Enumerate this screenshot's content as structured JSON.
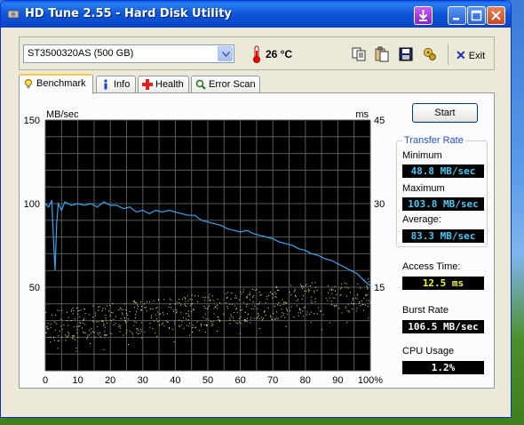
{
  "window": {
    "title": "HD Tune 2.55 - Hard Disk Utility"
  },
  "toolbar": {
    "drive": "ST3500320AS (500 GB)",
    "temperature": "26 °C",
    "exit_label": "Exit"
  },
  "tabs": [
    {
      "label": "Benchmark"
    },
    {
      "label": "Info"
    },
    {
      "label": "Health"
    },
    {
      "label": "Error Scan"
    }
  ],
  "buttons": {
    "start": "Start"
  },
  "stats": {
    "transfer_rate_title": "Transfer Rate",
    "minimum_label": "Minimum",
    "minimum_value": "48.8 MB/sec",
    "maximum_label": "Maximum",
    "maximum_value": "103.8 MB/sec",
    "average_label": "Average:",
    "average_value": "83.3 MB/sec",
    "access_label": "Access Time:",
    "access_value": "12.5 ms",
    "burst_label": "Burst Rate",
    "burst_value": "106.5 MB/sec",
    "cpu_label": "CPU Usage",
    "cpu_value": "1.2%"
  },
  "colors": {
    "transfer_line": "#3aa4f0",
    "access_dots": "#f0f080",
    "chart_bg": "#000000",
    "grid": "#5a5a5a"
  },
  "chart_data": {
    "type": "line",
    "ylabel_left": "MB/sec",
    "ylabel_right": "ms",
    "left_ticks": [
      "150",
      "100",
      "50"
    ],
    "right_ticks": [
      "45",
      "30",
      "15"
    ],
    "x_ticks": [
      "0",
      "10",
      "20",
      "30",
      "40",
      "50",
      "60",
      "70",
      "80",
      "90",
      "100%"
    ],
    "xlim": [
      0,
      100
    ],
    "ylim_left": [
      0,
      150
    ],
    "ylim_right": [
      0,
      45
    ],
    "grid": true,
    "series": [
      {
        "x": [
          0,
          1,
          2,
          2.5,
          3,
          3.5,
          4,
          5,
          6,
          8,
          10,
          12,
          14,
          16,
          18,
          20,
          22,
          24,
          26,
          28,
          30,
          32,
          34,
          36,
          38,
          40,
          42,
          44,
          46,
          48,
          50,
          52,
          54,
          56,
          58,
          60,
          62,
          64,
          66,
          68,
          70,
          72,
          74,
          76,
          78,
          80,
          82,
          84,
          86,
          88,
          90,
          92,
          94,
          96,
          98,
          100
        ],
        "y": [
          100,
          98,
          102,
          80,
          60,
          88,
          100,
          96,
          101,
          99,
          100,
          99,
          100,
          98,
          101,
          99,
          99,
          97,
          98,
          95,
          96,
          94,
          96,
          95,
          96,
          95,
          94,
          93,
          93,
          90,
          89,
          88,
          87,
          85,
          84,
          83,
          84,
          82,
          81,
          80,
          79,
          77,
          76,
          75,
          73,
          72,
          70,
          69,
          67,
          66,
          64,
          62,
          60,
          58,
          54,
          51
        ]
      }
    ],
    "access_time_ms": {
      "min": 3,
      "max": 21,
      "typical_range": [
        5,
        14
      ]
    }
  }
}
